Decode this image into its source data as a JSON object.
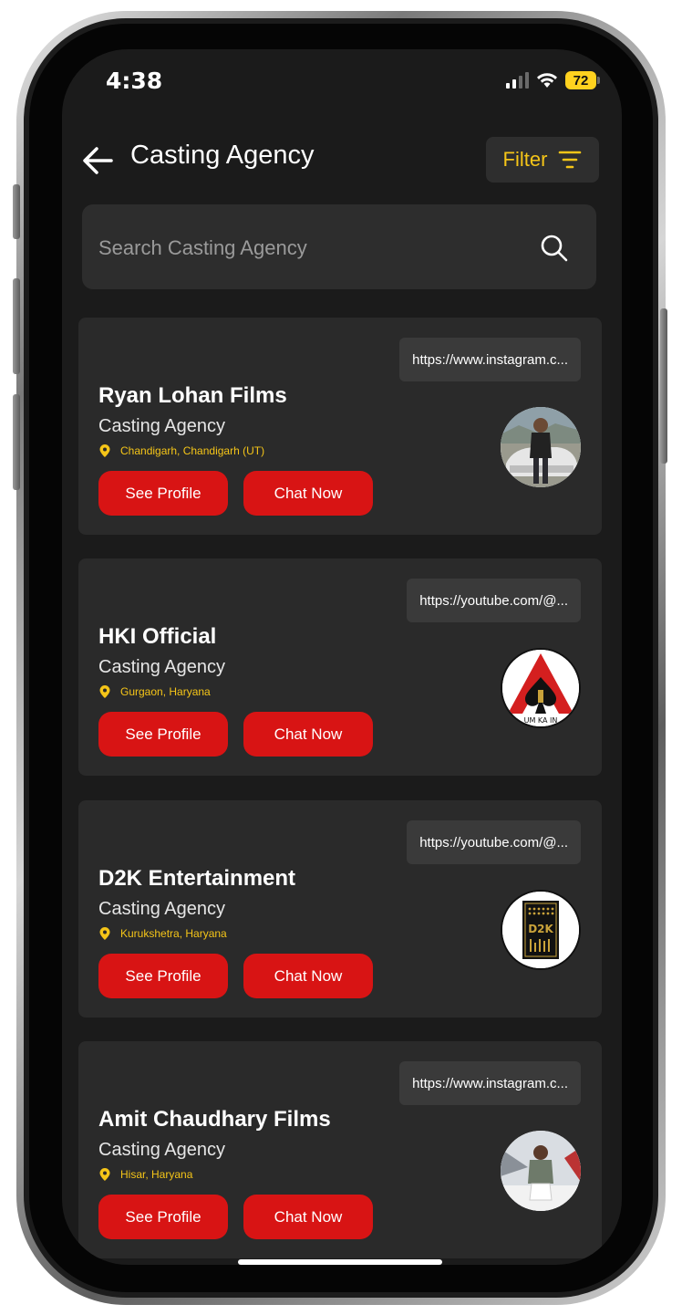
{
  "status": {
    "time": "4:38",
    "battery": "72"
  },
  "header": {
    "title": "Casting Agency",
    "filter_label": "Filter"
  },
  "search": {
    "placeholder": "Search Casting Agency"
  },
  "agencies": [
    {
      "name": "Ryan Lohan Films",
      "type": "Casting Agency",
      "location": "Chandigarh, Chandigarh (UT)",
      "link": "https://www.instagram.c...",
      "see_profile": "See Profile",
      "chat_now": "Chat Now"
    },
    {
      "name": "HKI Official",
      "type": "Casting Agency",
      "location": "Gurgaon, Haryana",
      "link": "https://youtube.com/@...",
      "see_profile": "See Profile",
      "chat_now": "Chat Now",
      "logo_text": "UM KA IN"
    },
    {
      "name": "D2K Entertainment",
      "type": "Casting Agency",
      "location": "Kurukshetra, Haryana",
      "link": "https://youtube.com/@...",
      "see_profile": "See Profile",
      "chat_now": "Chat Now",
      "logo_text": "D2K"
    },
    {
      "name": "Amit Chaudhary Films",
      "type": "Casting Agency",
      "location": "Hisar, Haryana",
      "link": "https://www.instagram.c...",
      "see_profile": "See Profile",
      "chat_now": "Chat Now"
    }
  ],
  "colors": {
    "accent_yellow": "#f5c518",
    "button_red": "#d81414",
    "card_bg": "#2a2a2a",
    "screen_bg": "#1b1b1b"
  }
}
